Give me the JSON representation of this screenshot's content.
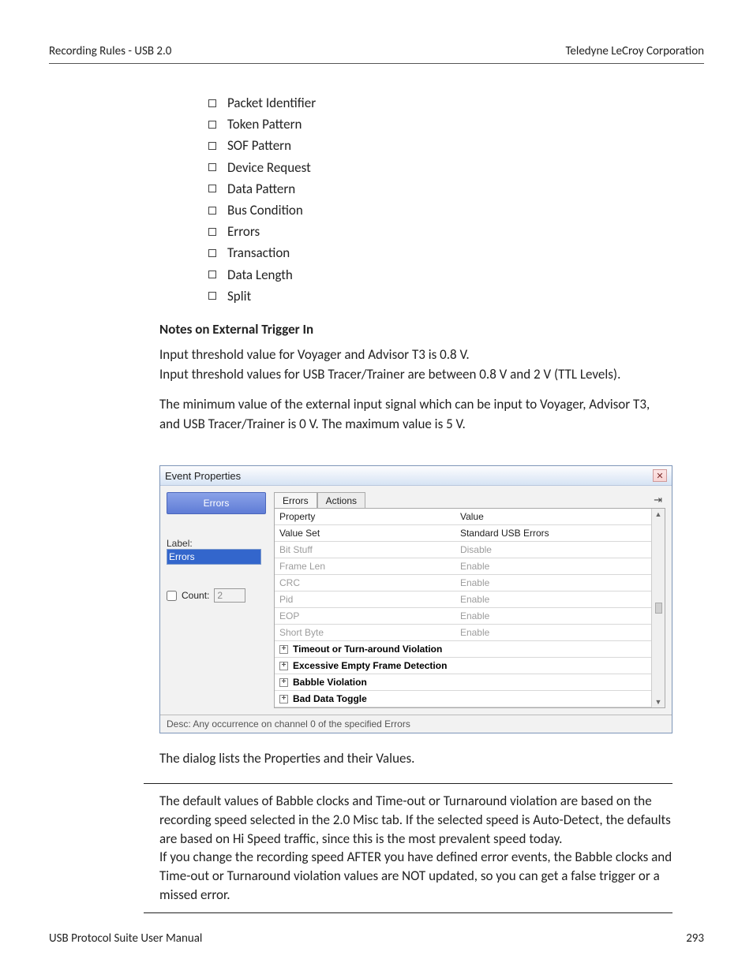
{
  "header": {
    "left": "Recording Rules - USB 2.0",
    "right": "Teledyne LeCroy Corporation"
  },
  "bullets": [
    "Packet Identifier",
    "Token Pattern",
    "SOF Pattern",
    "Device Request",
    "Data Pattern",
    "Bus Condition",
    "Errors",
    "Transaction",
    "Data Length",
    "Split"
  ],
  "subhead": "Notes on External Trigger In",
  "para1a": "Input threshold value for Voyager and Advisor T3 is 0.8 V.",
  "para1b": "Input threshold values for USB Tracer/Trainer are between 0.8 V and 2 V (TTL Levels).",
  "para2": "The minimum value of the external input signal which can be input to Voyager, Advisor T3, and USB Tracer/Trainer is 0 V. The maximum value is 5 V.",
  "dialog": {
    "title": "Event Properties",
    "left_button": "Errors",
    "label_caption": "Label:",
    "label_value": "Errors",
    "count_caption": "Count:",
    "count_value": "2",
    "tabs": [
      "Errors",
      "Actions"
    ],
    "grid_header": {
      "c1": "Property",
      "c2": "Value"
    },
    "rows": [
      {
        "c1": "Value Set",
        "c2": "Standard USB Errors",
        "dim": false
      },
      {
        "c1": "Bit Stuff",
        "c2": "Disable",
        "dim": true
      },
      {
        "c1": "Frame Len",
        "c2": "Enable",
        "dim": true
      },
      {
        "c1": "CRC",
        "c2": "Enable",
        "dim": true
      },
      {
        "c1": "Pid",
        "c2": "Enable",
        "dim": true
      },
      {
        "c1": "EOP",
        "c2": "Enable",
        "dim": true
      },
      {
        "c1": "Short Byte",
        "c2": "Enable",
        "dim": true
      }
    ],
    "groups": [
      "Timeout or Turn-around Violation",
      "Excessive Empty Frame Detection",
      "Babble Violation",
      "Bad Data Toggle"
    ],
    "desc": "Desc: Any occurrence on channel 0 of the specified Errors"
  },
  "after_dialog": "The dialog lists the Properties and their Values.",
  "note": "The default values of Babble clocks and Time-out or Turnaround violation are based on the recording speed selected in the 2.0 Misc tab. If the selected speed is Auto-Detect, the defaults are based on Hi Speed traffic, since this is the most prevalent speed today.\nIf you change the recording speed AFTER you have defined error events, the Babble clocks and Time-out or Turnaround violation values are NOT updated, so you can get a false trigger or a missed error.",
  "footer": {
    "left": "USB Protocol Suite User Manual",
    "right": "293"
  }
}
